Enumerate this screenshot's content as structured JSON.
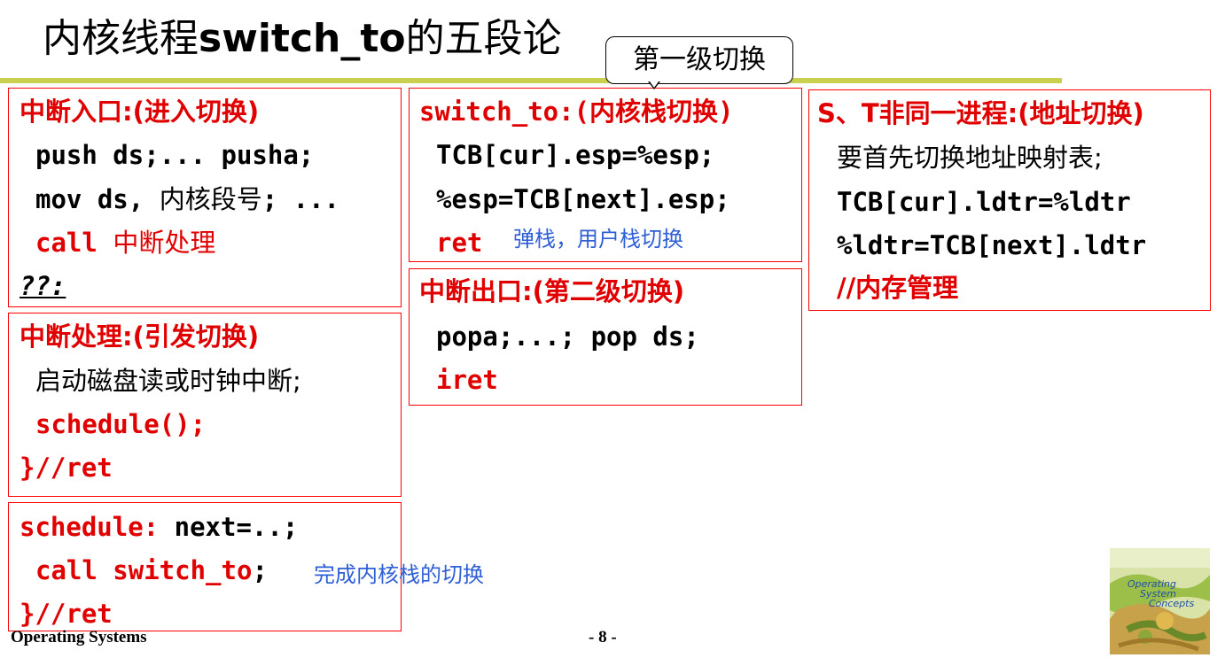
{
  "title": {
    "cn1": "内核线程",
    "en": "switch_to",
    "cn2": "的五段论"
  },
  "callout": {
    "label": "第一级切换"
  },
  "box_interrupt_entry": {
    "heading": "中断入口:(进入切换)",
    "line1": "push ds;... pusha;",
    "line2_a": "mov ds, ",
    "line2_b": "内核段号",
    "line2_c": "; ...",
    "line3_a": "call ",
    "line3_b": "中断处理",
    "line4": "??:"
  },
  "box_interrupt_handler": {
    "heading": "中断处理:(引发切换)",
    "line1": "启动磁盘读或时钟中断;",
    "line2": "schedule();",
    "line3": "}//ret"
  },
  "box_schedule": {
    "line1_a": "schedule: ",
    "line1_b": "next=..;",
    "line2_a": "call switch_to",
    "line2_b": ";",
    "note": "完成内核栈的切换",
    "line3": "}//ret"
  },
  "box_switch_to": {
    "heading": "switch_to:(内核栈切换)",
    "line1": "TCB[cur].esp=%esp;",
    "line2": "%esp=TCB[next].esp;",
    "line3": "ret",
    "note": "弹栈，用户栈切换"
  },
  "box_interrupt_exit": {
    "heading": "中断出口:(第二级切换)",
    "line1": "popa;...; pop ds;",
    "line2": "iret"
  },
  "box_address_switch": {
    "heading": "S、T非同一进程:(地址切换)",
    "line1": "要首先切换地址映射表;",
    "line2": "TCB[cur].ldtr=%ldtr",
    "line3": "%ldtr=TCB[next].ldtr",
    "line4": "//内存管理"
  },
  "footer": {
    "left": "Operating Systems",
    "page": "- 8 -"
  },
  "book": {
    "title_line1": "Operating",
    "title_line2": "System",
    "title_line3": "Concepts"
  },
  "colors": {
    "red": "#e00000",
    "blue": "#2f5fd6",
    "rule": "#c9cf4f",
    "box_border": "#ff0000"
  }
}
